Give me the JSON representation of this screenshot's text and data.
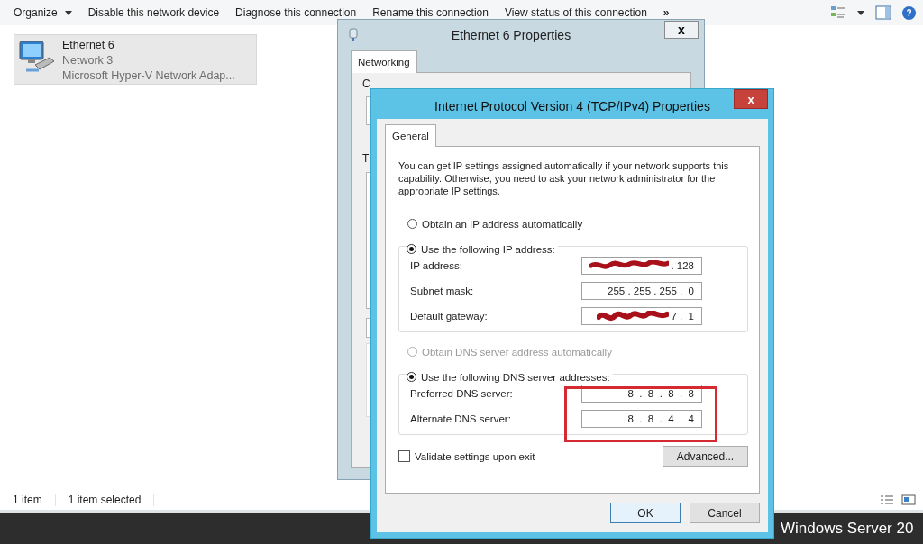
{
  "toolbar": {
    "items": [
      {
        "label": "Organize",
        "kind": "menu"
      },
      {
        "label": "Disable this network device",
        "kind": "button"
      },
      {
        "label": "Diagnose this connection",
        "kind": "button"
      },
      {
        "label": "Rename this connection",
        "kind": "button"
      },
      {
        "label": "View status of this connection",
        "kind": "button"
      },
      {
        "label": "»",
        "kind": "overflow"
      }
    ],
    "help": "?"
  },
  "connection": {
    "name": "Ethernet 6",
    "network": "Network  3",
    "adapter": "Microsoft Hyper-V Network Adap...",
    "selected": true
  },
  "status_bar": [
    "1 item",
    "1 item selected"
  ],
  "taskbar": {
    "brand": "Windows Server 20"
  },
  "ethernet_dialog": {
    "title": "Ethernet 6 Properties",
    "close": "x",
    "tabs": [
      {
        "label": "Networking",
        "selected": true
      }
    ],
    "behind_labels": [
      "C",
      "T"
    ]
  },
  "ipv4_dialog": {
    "title": "Internet Protocol Version 4 (TCP/IPv4) Properties",
    "close": "x",
    "tabs": [
      {
        "label": "General",
        "selected": true
      }
    ],
    "description": "You can get IP settings assigned automatically if your network supports this capability. Otherwise, you need to ask your network administrator for the appropriate IP settings.",
    "ip_options": [
      {
        "label": "Obtain an IP address automatically",
        "selected": false,
        "disabled": false
      },
      {
        "label": "Use the following IP address:",
        "selected": true,
        "disabled": false
      }
    ],
    "ip_fields": [
      {
        "label": "IP address:",
        "value": ". 128",
        "redacted": true
      },
      {
        "label": "Subnet mask:",
        "value": "255 . 255 . 255 .  0",
        "redacted": false
      },
      {
        "label": "Default gateway:",
        "value": "7 .  1",
        "redacted": true
      }
    ],
    "dns_options": [
      {
        "label": "Obtain DNS server address automatically",
        "selected": false,
        "disabled": true
      },
      {
        "label": "Use the following DNS server addresses:",
        "selected": true,
        "disabled": false
      }
    ],
    "dns_fields": [
      {
        "label": "Preferred DNS server:",
        "value": "8  .  8  .  8  .  8",
        "redacted": false
      },
      {
        "label": "Alternate DNS server:",
        "value": "8  .  8  .  4  .  4",
        "redacted": false
      }
    ],
    "dns_highlighted": true,
    "validate": {
      "label": "Validate settings upon exit",
      "checked": false
    },
    "advanced": "Advanced...",
    "buttons": [
      "OK",
      "Cancel"
    ]
  }
}
